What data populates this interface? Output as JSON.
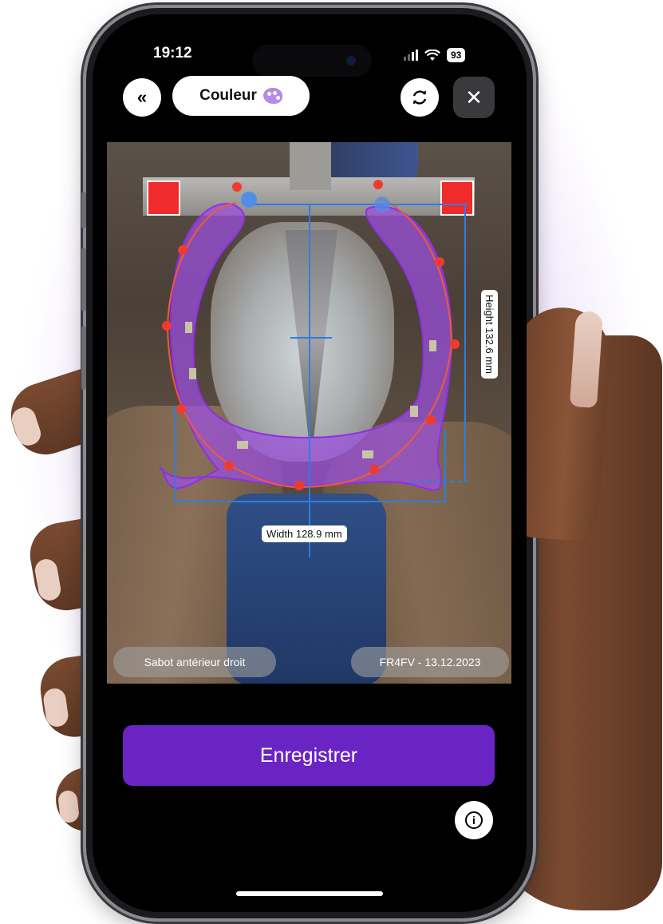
{
  "status_bar": {
    "time": "19:12",
    "battery": "93"
  },
  "toolbar": {
    "back_icon": "double-chevron-left-icon",
    "mode_label": "Couleur",
    "mode_icon": "palette-icon",
    "refresh_icon": "rotate-icon",
    "close_icon": "close-icon"
  },
  "measurement": {
    "width_label": "Width 128.9 mm",
    "height_label": "Height 132.6 mm"
  },
  "photo": {
    "hoof_label": "Sabot antérieur droit",
    "id_date_label": "FR4FV - 13.12.2023"
  },
  "actions": {
    "save_label": "Enregistrer",
    "info_icon": "info-icon"
  },
  "colors": {
    "accent": "#6a24c4",
    "overlay": "#9b4fe0",
    "control_point": "#ef3b2f",
    "guide_line": "#2f7de1"
  }
}
